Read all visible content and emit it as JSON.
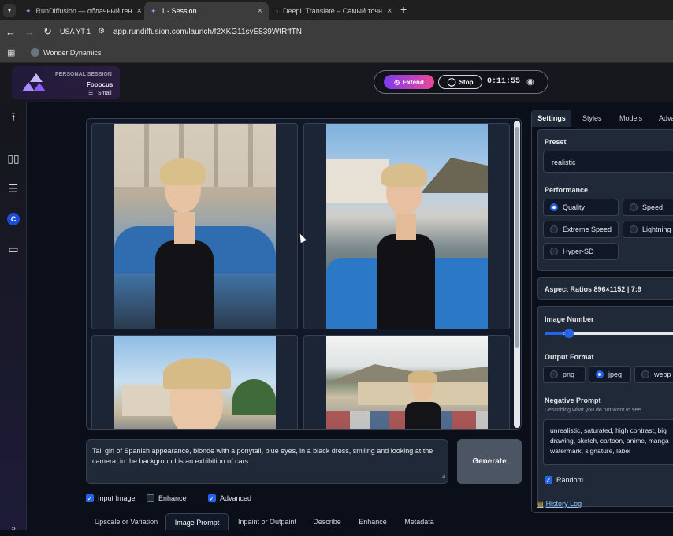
{
  "browser": {
    "tabs": [
      {
        "title": "RunDiffusion — облачный ген"
      },
      {
        "title": "1 - Session"
      },
      {
        "title": "DeepL Translate – Самый точн"
      }
    ],
    "profile_label": "USA YT 1",
    "url": "app.rundiffusion.com/launch/f2XKG11syE839WtRffTN",
    "bookmark": "Wonder Dynamics"
  },
  "session": {
    "kind": "PERSONAL SESSION",
    "app": "Fooocus",
    "size": "Small",
    "extend_label": "Extend",
    "stop_label": "Stop",
    "timer": "0:11:55"
  },
  "prompt": {
    "text": "Tall girl of Spanish appearance, blonde with a ponytail, blue eyes, in a black dress, smiling and looking at the camera, in the background is an exhibition of cars"
  },
  "generate_label": "Generate",
  "options": [
    {
      "label": "Input Image",
      "checked": true
    },
    {
      "label": "Enhance",
      "checked": false
    },
    {
      "label": "Advanced",
      "checked": true
    }
  ],
  "bottom_tabs": [
    "Upscale or Variation",
    "Image Prompt",
    "Inpaint or Outpaint",
    "Describe",
    "Enhance",
    "Metadata"
  ],
  "right_tabs": [
    "Settings",
    "Styles",
    "Models",
    "Adva"
  ],
  "preset": {
    "label": "Preset",
    "value": "realistic"
  },
  "performance": {
    "label": "Performance",
    "options": [
      "Quality",
      "Speed",
      "Extreme Speed",
      "Lightning",
      "Hyper-SD"
    ],
    "selected": "Quality"
  },
  "aspect_ratios": "Aspect Ratios 896×1152 | 7:9",
  "image_number": {
    "label": "Image Number",
    "value": 2,
    "max": 32
  },
  "output_format": {
    "label": "Output Format",
    "options": [
      "png",
      "jpeg",
      "webp"
    ],
    "selected": "jpeg"
  },
  "negative_prompt": {
    "label": "Negative Prompt",
    "hint": "Describing what you do not want to see.",
    "text": "unrealistic, saturated, high contrast, big drawing, sketch, cartoon, anime, manga watermark, signature, label"
  },
  "random": {
    "label": "Random",
    "checked": true
  },
  "history_log": "History Log",
  "colors": {
    "accent": "#2563eb",
    "extend": "#ec4899",
    "panel": "#1f2937"
  }
}
